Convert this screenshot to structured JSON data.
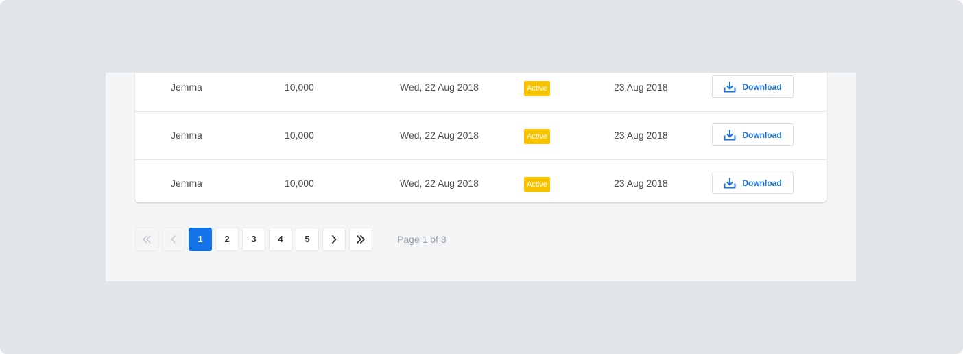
{
  "table": {
    "rows": [
      {
        "name": "Jemma",
        "amount": "10,000",
        "date": "Wed, 22 Aug 2018",
        "status": "Active",
        "expiry": "23 Aug 2018",
        "action": "Download"
      },
      {
        "name": "Jemma",
        "amount": "10,000",
        "date": "Wed, 22 Aug 2018",
        "status": "Active",
        "expiry": "23 Aug 2018",
        "action": "Download"
      },
      {
        "name": "Jemma",
        "amount": "10,000",
        "date": "Wed, 22 Aug 2018",
        "status": "Active",
        "expiry": "23 Aug 2018",
        "action": "Download"
      }
    ]
  },
  "pagination": {
    "first_icon": "double-chevron-left-icon",
    "prev_icon": "chevron-left-icon",
    "next_icon": "chevron-right-icon",
    "last_icon": "double-chevron-right-icon",
    "pages": [
      "1",
      "2",
      "3",
      "4",
      "5"
    ],
    "current_page": "1",
    "info": "Page 1 of 8"
  },
  "colors": {
    "accent": "#1473e6",
    "link": "#1a73d9",
    "badge_active": "#f7c300",
    "background": "#e2e5e8",
    "panel": "#f4f5f7"
  }
}
